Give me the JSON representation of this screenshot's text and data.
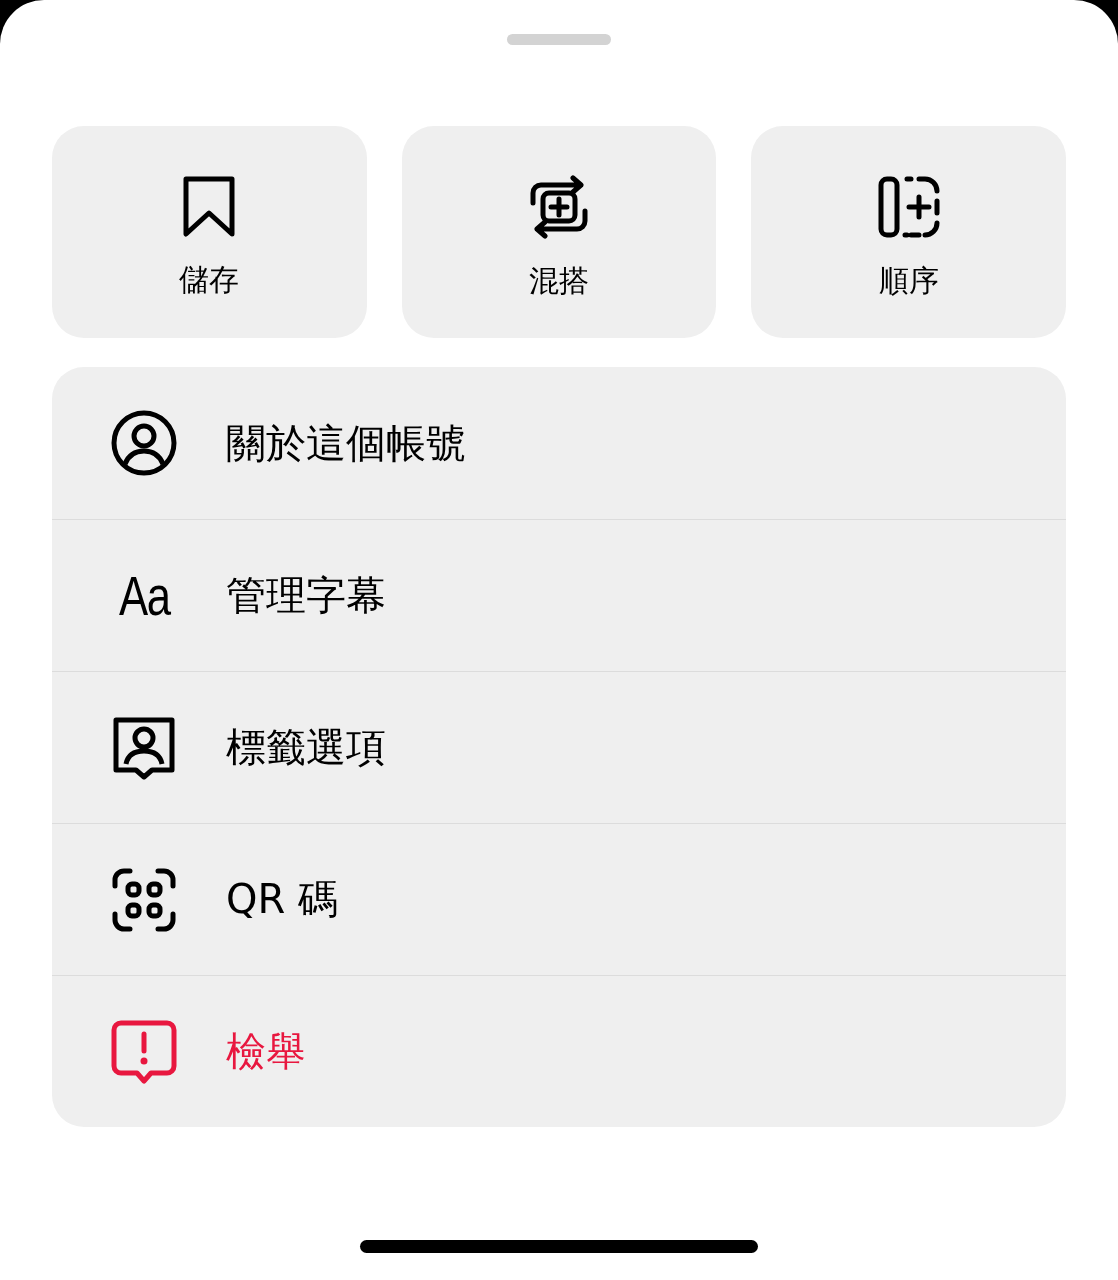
{
  "actions": [
    {
      "label": "儲存",
      "kind": "bookmark"
    },
    {
      "label": "混搭",
      "kind": "remix"
    },
    {
      "label": "順序",
      "kind": "sequence"
    }
  ],
  "menu": [
    {
      "label": "關於這個帳號",
      "kind": "account",
      "danger": false
    },
    {
      "label": "管理字幕",
      "kind": "captions",
      "icon_text": "Aa",
      "danger": false
    },
    {
      "label": "標籤選項",
      "kind": "tag",
      "danger": false
    },
    {
      "label": "QR 碼",
      "kind": "qr",
      "danger": false
    },
    {
      "label": "檢舉",
      "kind": "report",
      "danger": true
    }
  ]
}
